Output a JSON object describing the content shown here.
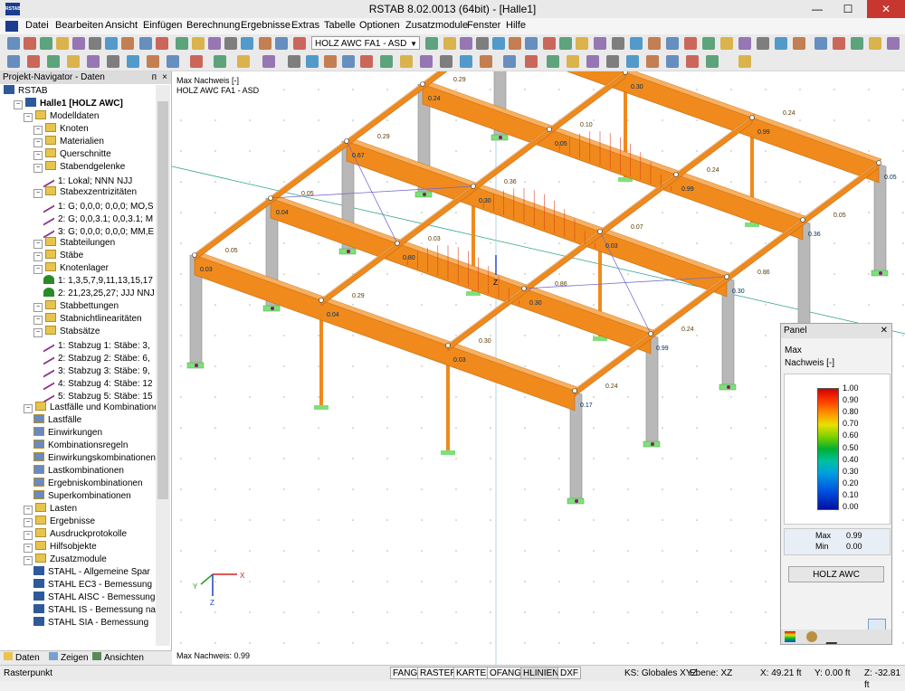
{
  "window": {
    "title": "RSTAB 8.02.0013 (64bit) - [Halle1]",
    "app_icon": "RSTAB",
    "minimize": "—",
    "maximize": "☐",
    "close": "✕"
  },
  "menu": [
    "Datei",
    "Bearbeiten",
    "Ansicht",
    "Einfügen",
    "Berechnung",
    "Ergebnisse",
    "Extras",
    "Tabelle",
    "Optionen",
    "Zusatzmodule",
    "Fenster",
    "Hilfe"
  ],
  "toolbar": {
    "loadcase_combo": "HOLZ AWC FA1 - ASD"
  },
  "navigator": {
    "title": "Projekt-Navigator - Daten",
    "pin": "ᴨ",
    "close": "×",
    "items": [
      {
        "label": "RSTAB",
        "level": 0,
        "icon": "rstab-icon"
      },
      {
        "label": "Halle1 [HOLZ AWC]",
        "level": 1,
        "icon": "model-icon",
        "bold": true
      },
      {
        "label": "Modelldaten",
        "level": 2,
        "icon": "folder-icon"
      },
      {
        "label": "Knoten",
        "level": 3,
        "icon": "folder-icon"
      },
      {
        "label": "Materialien",
        "level": 3,
        "icon": "folder-icon"
      },
      {
        "label": "Querschnitte",
        "level": 3,
        "icon": "folder-icon"
      },
      {
        "label": "Stabendgelenke",
        "level": 3,
        "icon": "folder-icon"
      },
      {
        "label": "1: Lokal; NNN NJJ",
        "level": 4,
        "icon": "hinge-icon"
      },
      {
        "label": "Stabexzentrizitäten",
        "level": 3,
        "icon": "folder-icon"
      },
      {
        "label": "1: G; 0,0,0; 0,0,0; MO,S",
        "level": 4,
        "icon": "eccentricity-icon"
      },
      {
        "label": "2: G; 0,0,3.1; 0,0,3.1; M",
        "level": 4,
        "icon": "eccentricity-icon"
      },
      {
        "label": "3: G; 0,0,0; 0,0,0; MM,E",
        "level": 4,
        "icon": "eccentricity-icon"
      },
      {
        "label": "Stabteilungen",
        "level": 3,
        "icon": "folder-icon"
      },
      {
        "label": "Stäbe",
        "level": 3,
        "icon": "folder-icon"
      },
      {
        "label": "Knotenlager",
        "level": 3,
        "icon": "folder-icon"
      },
      {
        "label": "1: 1,3,5,7,9,11,13,15,17",
        "level": 4,
        "icon": "support-icon"
      },
      {
        "label": "2: 21,23,25,27; JJJ NNJ",
        "level": 4,
        "icon": "support-icon"
      },
      {
        "label": "Stabbettungen",
        "level": 3,
        "icon": "folder-icon"
      },
      {
        "label": "Stabnichtlinearitäten",
        "level": 3,
        "icon": "folder-icon"
      },
      {
        "label": "Stabsätze",
        "level": 3,
        "icon": "folder-icon"
      },
      {
        "label": "1: Stabzug 1: Stäbe: 3,",
        "level": 4,
        "icon": "member-set-icon"
      },
      {
        "label": "2: Stabzug 2: Stäbe: 6,",
        "level": 4,
        "icon": "member-set-icon"
      },
      {
        "label": "3: Stabzug 3: Stäbe: 9,",
        "level": 4,
        "icon": "member-set-icon"
      },
      {
        "label": "4: Stabzug 4: Stäbe: 12",
        "level": 4,
        "icon": "member-set-icon"
      },
      {
        "label": "5: Stabzug 5: Stäbe: 15",
        "level": 4,
        "icon": "member-set-icon"
      },
      {
        "label": "Lastfälle und Kombinationen",
        "level": 2,
        "icon": "folder-icon"
      },
      {
        "label": "Lastfälle",
        "level": 3,
        "icon": "loadcase-icon"
      },
      {
        "label": "Einwirkungen",
        "level": 3,
        "icon": "action-icon"
      },
      {
        "label": "Kombinationsregeln",
        "level": 3,
        "icon": "rule-icon"
      },
      {
        "label": "Einwirkungskombinationen",
        "level": 3,
        "icon": "combination-icon"
      },
      {
        "label": "Lastkombinationen",
        "level": 3,
        "icon": "combination-icon"
      },
      {
        "label": "Ergebniskombinationen",
        "level": 3,
        "icon": "combination-icon"
      },
      {
        "label": "Superkombinationen",
        "level": 3,
        "icon": "combination-icon"
      },
      {
        "label": "Lasten",
        "level": 2,
        "icon": "folder-icon"
      },
      {
        "label": "Ergebnisse",
        "level": 2,
        "icon": "folder-icon"
      },
      {
        "label": "Ausdruckprotokolle",
        "level": 2,
        "icon": "folder-icon"
      },
      {
        "label": "Hilfsobjekte",
        "level": 2,
        "icon": "folder-icon"
      },
      {
        "label": "Zusatzmodule",
        "level": 2,
        "icon": "folder-icon"
      },
      {
        "label": "STAHL - Allgemeine Spar",
        "level": 3,
        "icon": "module-icon"
      },
      {
        "label": "STAHL EC3 - Bemessung",
        "level": 3,
        "icon": "module-icon"
      },
      {
        "label": "STAHL AISC - Bemessung",
        "level": 3,
        "icon": "module-icon"
      },
      {
        "label": "STAHL IS - Bemessung na",
        "level": 3,
        "icon": "module-icon"
      },
      {
        "label": "STAHL SIA - Bemessung",
        "level": 3,
        "icon": "module-icon"
      }
    ],
    "tabs": [
      "Daten",
      "Zeigen",
      "Ansichten"
    ]
  },
  "viewport": {
    "title_line1": "Max Nachweis [-]",
    "title_line2": "HOLZ AWC FA1 - ASD",
    "footer": "Max Nachweis: 0.99",
    "axes": {
      "x": "X",
      "y": "Y",
      "z": "Z"
    },
    "global_z_label": "Z",
    "beam_values": [
      "0.03",
      "0.05",
      "0.04",
      "0.29",
      "0.03",
      "0.30",
      "0.17",
      "0.24",
      "0.04",
      "0.05",
      "0.80",
      "0.03",
      "0.30",
      "0.86",
      "0.99",
      "0.24",
      "0.67",
      "0.29",
      "0.30",
      "0.36",
      "0.03",
      "0.07",
      "0.30",
      "0.86",
      "0.24",
      "0.29",
      "0.05",
      "0.10",
      "0.99",
      "0.24",
      "0.36",
      "0.05",
      "0.04",
      "0.29",
      "0.30",
      "0.86",
      "0.99",
      "0.24",
      "0.05",
      "0.24",
      "0.03",
      "0.16",
      "0.04",
      "0.24",
      "0.80",
      "0.03",
      "0.05",
      "0.25",
      "0.80",
      "0.25",
      "0.39",
      "0.05"
    ]
  },
  "panel": {
    "title": "Panel",
    "close": "✕",
    "line1": "Max",
    "line2": "Nachweis [-]",
    "legend_values": [
      "1.00",
      "0.90",
      "0.80",
      "0.70",
      "0.60",
      "0.50",
      "0.40",
      "0.30",
      "0.20",
      "0.10",
      "0.00"
    ],
    "max_label": "Max",
    "max_value": "0.99",
    "min_label": "Min",
    "min_value": "0.00",
    "button": "HOLZ AWC"
  },
  "statusbar": {
    "left": "Rasterpunkt",
    "toggles": [
      "FANG",
      "RASTER",
      "KARTES",
      "OFANG",
      "HLINIEN",
      "DXF"
    ],
    "active_toggle": "HLINIEN",
    "cs": "KS: Globales XYZ",
    "plane": "Ebene: XZ",
    "x": "X: 49.21 ft",
    "y": "Y: 0.00 ft",
    "z": "Z: -32.81 ft"
  },
  "colors": {
    "beam": "#f08a1c",
    "beam_dark": "#c46a10",
    "column": "#b8b8b8",
    "support": "#7ee07a",
    "accent": "#1a3d8f"
  }
}
